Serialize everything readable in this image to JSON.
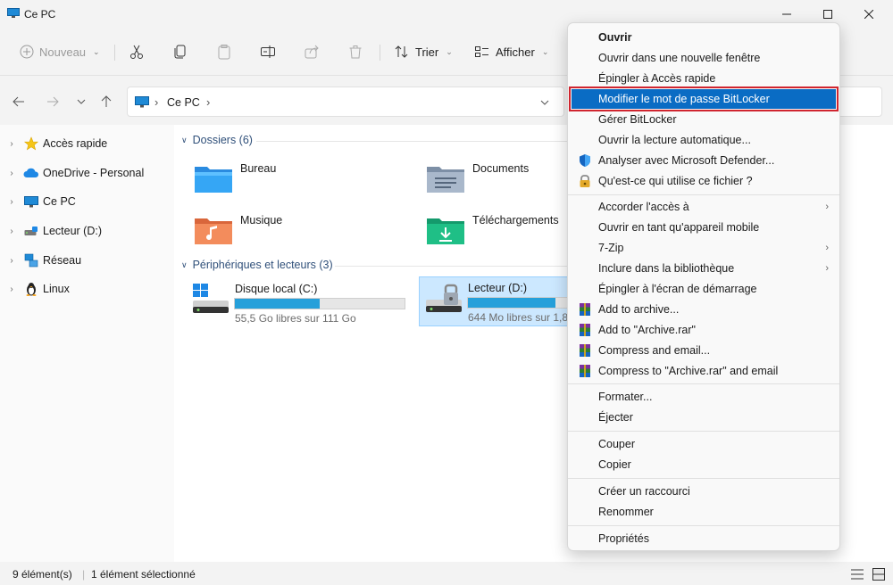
{
  "window": {
    "title": "Ce PC",
    "minimize": "—",
    "maximize": "☐",
    "close": "✕"
  },
  "toolbar": {
    "new_label": "Nouveau",
    "sort_label": "Trier",
    "view_label": "Afficher"
  },
  "address": {
    "location": "Ce PC",
    "separator": "›"
  },
  "nav": {
    "items": [
      {
        "label": "Accès rapide"
      },
      {
        "label": "OneDrive - Personal"
      },
      {
        "label": "Ce PC"
      },
      {
        "label": "Lecteur (D:)"
      },
      {
        "label": "Réseau"
      },
      {
        "label": "Linux"
      }
    ]
  },
  "content": {
    "folders_header": "Dossiers (6)",
    "folders": [
      {
        "label": "Bureau"
      },
      {
        "label": "Documents"
      },
      {
        "label": "Musique"
      },
      {
        "label": "Téléchargements"
      }
    ],
    "devices_header": "Périphériques et lecteurs (3)",
    "drives": [
      {
        "name": "Disque local (C:)",
        "free": "55,5 Go libres sur 111 Go",
        "used_fraction": 0.5
      },
      {
        "name": "Lecteur (D:)",
        "free": "644 Mo libres sur 1,8",
        "used_fraction": 0.66
      }
    ]
  },
  "status": {
    "count": "9 élément(s)",
    "selected": "1 élément sélectionné"
  },
  "context_menu": {
    "items": [
      {
        "label": "Ouvrir"
      },
      {
        "label": "Ouvrir dans une nouvelle fenêtre"
      },
      {
        "label": "Épingler à Accès rapide"
      },
      {
        "label": "Modifier le mot de passe BitLocker"
      },
      {
        "label": "Gérer BitLocker"
      },
      {
        "label": "Ouvrir la lecture automatique..."
      },
      {
        "label": "Analyser avec Microsoft Defender..."
      },
      {
        "label": "Qu'est-ce qui utilise ce fichier ?"
      },
      {
        "label": "Accorder l'accès à"
      },
      {
        "label": "Ouvrir en tant qu'appareil mobile"
      },
      {
        "label": "7-Zip"
      },
      {
        "label": "Inclure dans la bibliothèque"
      },
      {
        "label": "Épingler à l'écran de démarrage"
      },
      {
        "label": "Add to archive..."
      },
      {
        "label": "Add to \"Archive.rar\""
      },
      {
        "label": "Compress and email..."
      },
      {
        "label": "Compress to \"Archive.rar\" and email"
      },
      {
        "label": "Formater..."
      },
      {
        "label": "Éjecter"
      },
      {
        "label": "Couper"
      },
      {
        "label": "Copier"
      },
      {
        "label": "Créer un raccourci"
      },
      {
        "label": "Renommer"
      },
      {
        "label": "Propriétés"
      }
    ],
    "submenu_arrow": "›"
  }
}
